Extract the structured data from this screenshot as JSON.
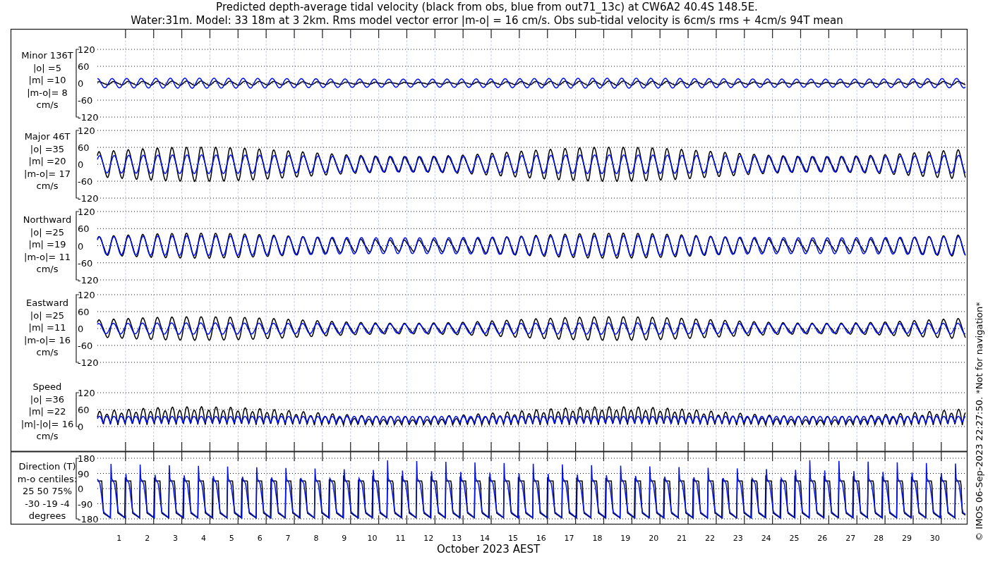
{
  "title": [
    "Predicted depth-average tidal velocity (black from obs, blue from out71_13c) at CW6A2 40.4S 148.5E.",
    "Water:31m. Model: 33 18m at 3 2km. Rms model vector error |m-o| = 16 cm/s. Obs sub-tidal velocity is 6cm/s rms + 4cm/s 94T mean"
  ],
  "panels": [
    {
      "kind": "velocity",
      "label_lines": [
        "Minor 136T",
        "|o| =5",
        "|m| =10",
        "|m-o|= 8",
        "cm/s"
      ],
      "yticks": [
        "120",
        "60",
        "0",
        "-60",
        "-120"
      ]
    },
    {
      "kind": "velocity",
      "label_lines": [
        "Major 46T",
        "|o| =35",
        "|m| =20",
        "|m-o|= 17",
        "cm/s"
      ],
      "yticks": [
        "120",
        "60",
        "0",
        "-60",
        "-120"
      ]
    },
    {
      "kind": "velocity",
      "label_lines": [
        "Northward",
        "|o| =25",
        "|m| =19",
        "|m-o|= 11",
        "cm/s"
      ],
      "yticks": [
        "120",
        "60",
        "0",
        "-60",
        "-120"
      ]
    },
    {
      "kind": "velocity",
      "label_lines": [
        "Eastward",
        "|o| =25",
        "|m| =11",
        "|m-o|= 16",
        "cm/s"
      ],
      "yticks": [
        "120",
        "60",
        "0",
        "-60",
        "-120"
      ]
    },
    {
      "kind": "speed",
      "label_lines": [
        "Speed",
        "|o| =36",
        "|m| =22",
        "|m|-|o|= 16",
        "cm/s"
      ],
      "yticks": [
        "120",
        "60",
        "0"
      ]
    },
    {
      "kind": "direction",
      "label_lines": [
        "Direction (T)",
        "m-o centiles:",
        "25  50  75%",
        "-30 -19  -4",
        "degrees"
      ],
      "yticks": [
        "180",
        "90",
        "0",
        "-90",
        "-180"
      ]
    }
  ],
  "x_axis": {
    "day_labels": [
      "1",
      "2",
      "3",
      "4",
      "5",
      "6",
      "7",
      "8",
      "9",
      "10",
      "11",
      "12",
      "13",
      "14",
      "15",
      "16",
      "17",
      "18",
      "19",
      "20",
      "21",
      "22",
      "23",
      "24",
      "25",
      "26",
      "27",
      "28",
      "29",
      "30"
    ],
    "label": "October 2023 AEST"
  },
  "credit": "© IMOS 06-Sep-2023 22:27:50. *Not for navigation*"
}
